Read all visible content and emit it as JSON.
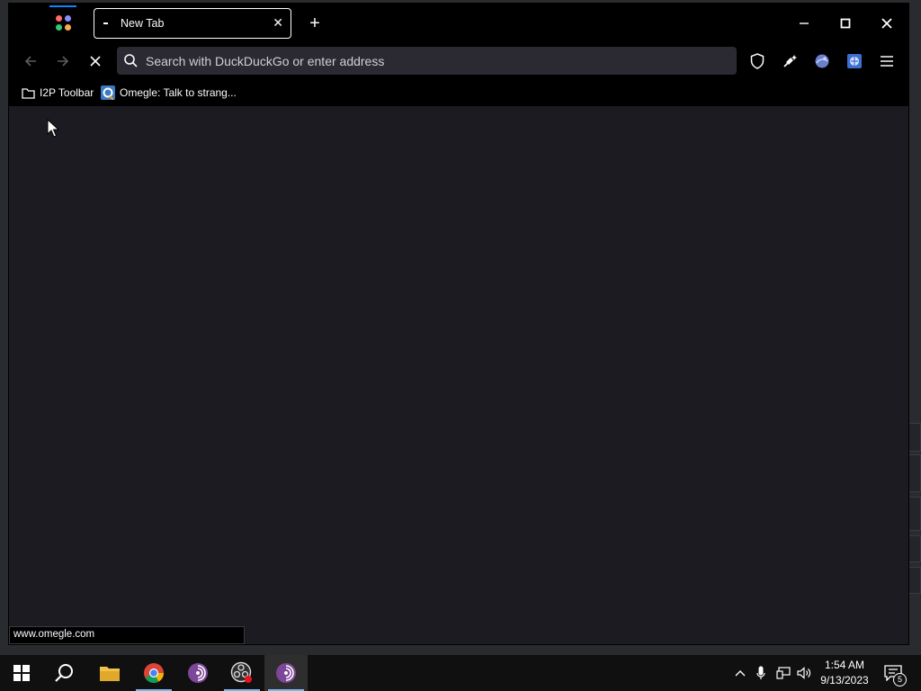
{
  "browser": {
    "tab": {
      "title": "New Tab"
    },
    "urlbar": {
      "placeholder": "Search with DuckDuckGo or enter address"
    },
    "bookmarks": [
      {
        "label": "I2P Toolbar",
        "icon": "folder-icon"
      },
      {
        "label": "Omegle: Talk to strang...",
        "icon": "omegle-favicon"
      }
    ],
    "status_url": "www.omegle.com"
  },
  "taskbar": {
    "apps": [
      "windows-start",
      "search",
      "file-explorer",
      "google-chrome",
      "tor-browser",
      "obs-studio",
      "tor-browser-active"
    ],
    "time": "1:54 AM",
    "date": "9/13/2023",
    "notification_count": "5"
  },
  "colors": {
    "accent": "#0a84ff",
    "chrome": "#000000",
    "content_bg": "#1c1b22",
    "urlbar_bg": "#2b2a33"
  }
}
